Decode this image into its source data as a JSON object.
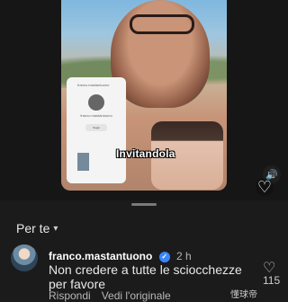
{
  "video": {
    "caption": "Invitandola",
    "profile_card": {
      "account": "franco.mastantuono",
      "button_label": "Segui"
    }
  },
  "icons": {
    "sound": "sound-icon",
    "favorite": "heart-icon"
  },
  "sheet": {
    "filter_label": "Per te"
  },
  "comment": {
    "username": "franco.mastantuono",
    "time": "2 h",
    "text": "Non credere a tutte le sciocchezze per favore",
    "actions": [
      "Rispondi",
      "Vedi l'originale"
    ],
    "likes": "115",
    "watermark": "懂球帝"
  }
}
